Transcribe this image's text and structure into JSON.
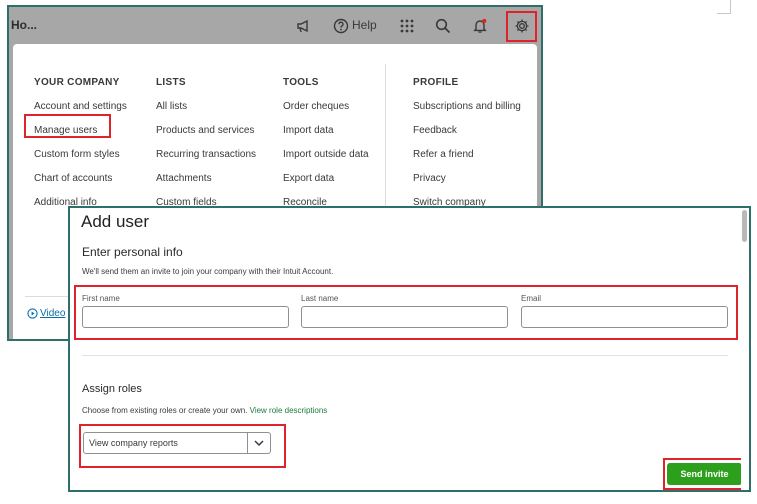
{
  "topbar": {
    "title": "Ho...",
    "help_label": "Help",
    "icons": [
      "megaphone-icon",
      "help-icon",
      "apps-grid-icon",
      "search-icon",
      "bell-icon",
      "gear-icon"
    ]
  },
  "menu": {
    "columns": [
      {
        "heading": "YOUR COMPANY",
        "items": [
          "Account and settings",
          "Manage users",
          "Custom form styles",
          "Chart of accounts",
          "Additional info"
        ]
      },
      {
        "heading": "LISTS",
        "items": [
          "All lists",
          "Products and services",
          "Recurring transactions",
          "Attachments",
          "Custom fields"
        ]
      },
      {
        "heading": "TOOLS",
        "items": [
          "Order cheques",
          "Import data",
          "Import outside data",
          "Export data",
          "Reconcile"
        ]
      },
      {
        "heading": "PROFILE",
        "items": [
          "Subscriptions and billing",
          "Feedback",
          "Refer a friend",
          "Privacy",
          "Switch company"
        ]
      }
    ],
    "video_link": "Video"
  },
  "dialog": {
    "title": "Add user",
    "personal_title": "Enter personal info",
    "personal_desc": "We'll send them an invite to join your company with their Intuit Account.",
    "fields": [
      {
        "label": "First name",
        "value": ""
      },
      {
        "label": "Last name",
        "value": ""
      },
      {
        "label": "Email",
        "value": ""
      }
    ],
    "roles_title": "Assign roles",
    "roles_desc": "Choose from existing roles or create your own.",
    "roles_link": "View role descriptions",
    "role_selected": "View company reports",
    "send_label": "Send invite"
  },
  "colors": {
    "highlight": "#e0232a",
    "primary_green": "#2ca01c",
    "window_border": "#2f6f6b"
  }
}
